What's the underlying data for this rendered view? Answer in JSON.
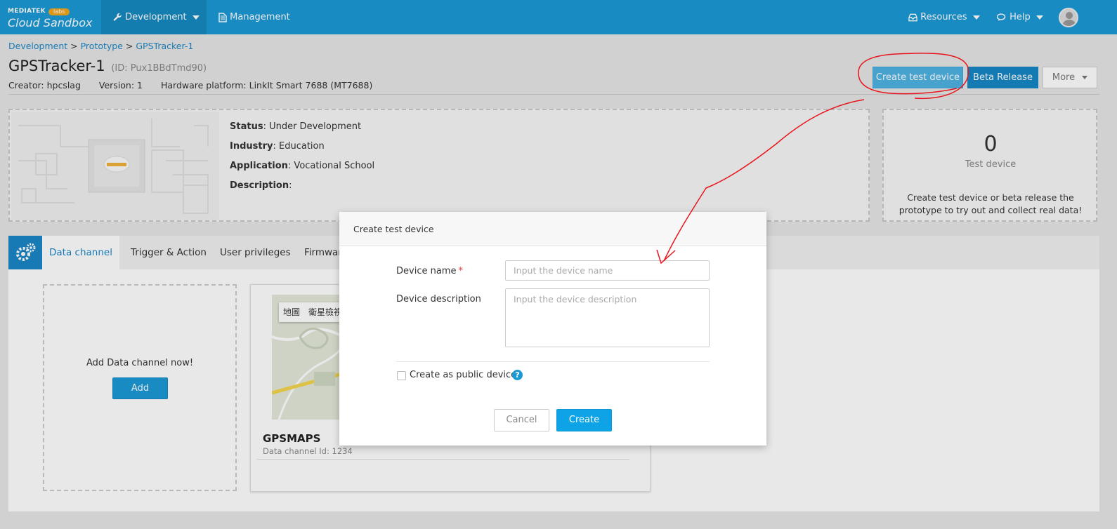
{
  "brand": {
    "company": "MEDIATEK",
    "badge": "labs",
    "product": "Cloud Sandbox"
  },
  "nav": {
    "left": [
      {
        "label": "Development",
        "icon": "wrench-icon",
        "active": true,
        "dropdown": true
      },
      {
        "label": "Management",
        "icon": "document-icon",
        "active": false,
        "dropdown": false
      }
    ],
    "right": [
      {
        "label": "Resources",
        "icon": "inbox-icon",
        "dropdown": true
      },
      {
        "label": "Help",
        "icon": "chat-icon",
        "dropdown": true
      }
    ]
  },
  "breadcrumb": {
    "items": [
      "Development",
      "Prototype",
      "GPSTracker-1"
    ],
    "separator": ">"
  },
  "prototype": {
    "name": "GPSTracker-1",
    "id_text": "(ID: Pux1BBdTmd90)",
    "creator": "Creator: hpcslag",
    "version": "Version: 1",
    "hardware": "Hardware platform: LinkIt Smart 7688 (MT7688)"
  },
  "actions": {
    "create_test_device": "Create test device",
    "beta_release": "Beta Release",
    "more": "More"
  },
  "details": {
    "status_label": "Status",
    "status": ": Under Development",
    "industry_label": "Industry",
    "industry": ": Education",
    "application_label": "Application",
    "application": ": Vocational School",
    "description_label": "Description",
    "description": ":"
  },
  "test_device": {
    "count": "0",
    "label": "Test device",
    "message": "Create test device or beta release the prototype to try out and collect real data!"
  },
  "tabs": [
    "Data channel",
    "Trigger & Action",
    "User privileges",
    "Firmware"
  ],
  "data_channel": {
    "add_prompt": "Add Data channel now!",
    "add_button": "Add",
    "card": {
      "map_buttons": [
        "地圖",
        "衛星檢視"
      ],
      "title": "GPSMAPS",
      "subtitle": "Data channel Id: 1234"
    }
  },
  "modal": {
    "title": "Create test device",
    "device_name_label": "Device name",
    "required_mark": "*",
    "device_name_placeholder": "Input the device name",
    "device_name_value": "",
    "device_description_label": "Device description",
    "device_description_placeholder": "Input the device description",
    "public_checkbox_label": "Create as public device",
    "public_checked": false,
    "help_glyph": "?",
    "cancel": "Cancel",
    "create": "Create"
  },
  "colors": {
    "nav": "#1b99d6",
    "primary": "#1b99d6",
    "link": "#1b87c7",
    "annotation": "#e8141c"
  }
}
